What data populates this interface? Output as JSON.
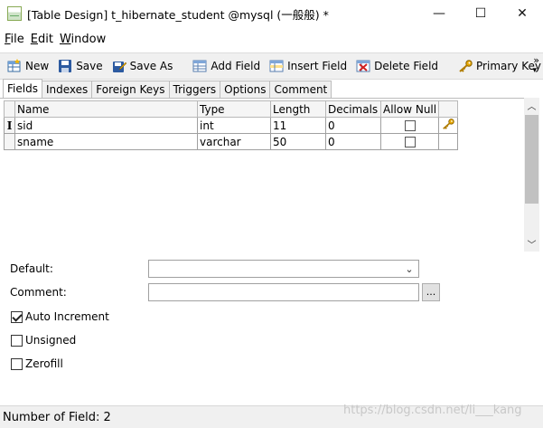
{
  "window": {
    "title": "[Table Design] t_hibernate_student @mysql (一般般) *",
    "minimize": "—",
    "maximize": "☐",
    "close": "✕"
  },
  "menu": {
    "items": [
      {
        "key": "F",
        "rest": "ile"
      },
      {
        "key": "E",
        "rest": "dit"
      },
      {
        "key": "W",
        "rest": "indow"
      }
    ]
  },
  "toolbar": {
    "new": "New",
    "save": "Save",
    "save_as": "Save As",
    "add_field": "Add Field",
    "insert_field": "Insert Field",
    "delete_field": "Delete Field",
    "primary_key": "Primary Key",
    "more": "»"
  },
  "tabs": [
    "Fields",
    "Indexes",
    "Foreign Keys",
    "Triggers",
    "Options",
    "Comment"
  ],
  "grid": {
    "columns": [
      "Name",
      "Type",
      "Length",
      "Decimals",
      "Allow Null",
      ""
    ],
    "rows": [
      {
        "name": "sid",
        "type": "int",
        "length": "11",
        "decimals": "0",
        "allow_null": false,
        "primary_key": true,
        "current": true
      },
      {
        "name": "sname",
        "type": "varchar",
        "length": "50",
        "decimals": "0",
        "allow_null": false,
        "primary_key": false,
        "current": false
      }
    ],
    "current_row_marker": "I"
  },
  "properties": {
    "default_label": "Default:",
    "comment_label": "Comment:",
    "ellipsis": "...",
    "auto_increment_label": "Auto Increment",
    "auto_increment": true,
    "unsigned_label": "Unsigned",
    "unsigned": false,
    "zerofill_label": "Zerofill",
    "zerofill": false
  },
  "status": {
    "text": "Number of Field: 2",
    "watermark": "https://blog.csdn.net/li___kang"
  }
}
